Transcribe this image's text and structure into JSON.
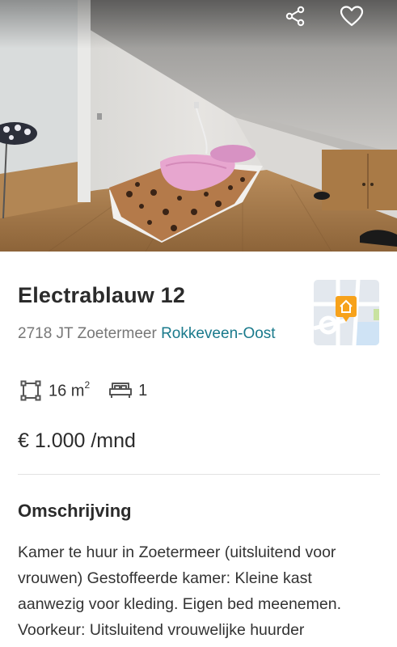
{
  "photo": {
    "alt_subject": "room-photo",
    "actions": [
      {
        "name": "share-icon"
      },
      {
        "name": "heart-icon"
      }
    ]
  },
  "listing": {
    "title": "Electrablauw 12",
    "postcode_city": "2718 JT Zoetermeer",
    "district": "Rokkeveen-Oost",
    "area_value": "16 m",
    "area_unit_sup": "2",
    "bedrooms": "1",
    "price": "€ 1.000 /mnd"
  },
  "description": {
    "heading": "Omschrijving",
    "text": "Kamer te huur in Zoetermeer (uitsluitend voor vrouwen) Gestoffeerde kamer: Kleine kast aanwezig voor kleding. Eigen bed meenemen. Voorkeur: Uitsluitend vrouwelijke huurder"
  },
  "colors": {
    "link": "#1a7a8c",
    "map_marker": "#f7a21b",
    "text": "#333333",
    "muted": "#777777"
  }
}
